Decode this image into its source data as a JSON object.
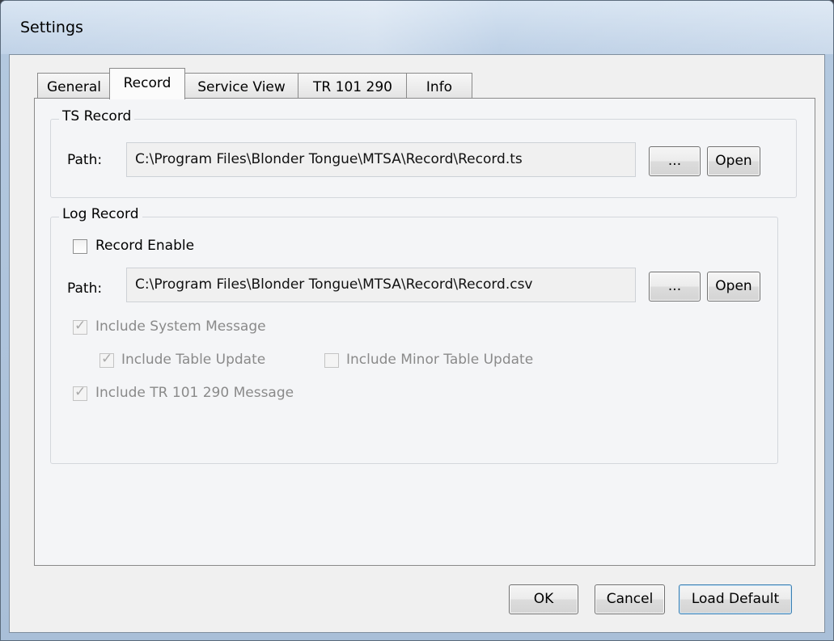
{
  "window": {
    "title": "Settings"
  },
  "tabs": [
    {
      "label": "General",
      "active": false
    },
    {
      "label": "Record",
      "active": true
    },
    {
      "label": "Service View",
      "active": false
    },
    {
      "label": "TR 101 290",
      "active": false
    },
    {
      "label": "Info",
      "active": false
    }
  ],
  "ts_record": {
    "group_label": "TS Record",
    "path_label": "Path:",
    "path_value": "C:\\Program Files\\Blonder Tongue\\MTSA\\Record\\Record.ts",
    "browse_label": "...",
    "open_label": "Open"
  },
  "log_record": {
    "group_label": "Log Record",
    "record_enable": {
      "label": "Record Enable",
      "checked": false
    },
    "path_label": "Path:",
    "path_value": "C:\\Program Files\\Blonder Tongue\\MTSA\\Record\\Record.csv",
    "browse_label": "...",
    "open_label": "Open",
    "include_system_message": {
      "label": "Include System Message",
      "checked": true,
      "enabled": false
    },
    "include_table_update": {
      "label": "Include Table Update",
      "checked": true,
      "enabled": false
    },
    "include_minor_table_update": {
      "label": "Include Minor Table Update",
      "checked": false,
      "enabled": false
    },
    "include_tr_message": {
      "label": "Include TR 101 290 Message",
      "checked": true,
      "enabled": false
    }
  },
  "footer": {
    "ok_label": "OK",
    "cancel_label": "Cancel",
    "load_default_label": "Load Default"
  },
  "colors": {
    "window_frame": "#b3c8df",
    "dialog_bg": "#f0f0f0",
    "focus_border": "#3c7fb1"
  },
  "icons": {
    "checkmark": "checkmark-icon"
  }
}
